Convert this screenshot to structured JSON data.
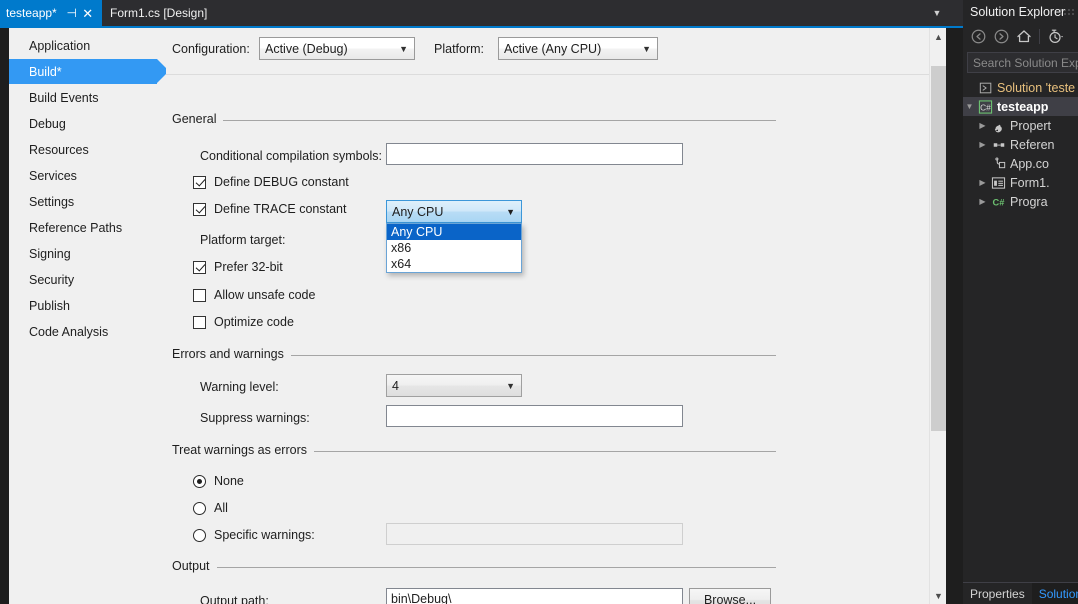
{
  "window": {
    "tabs": [
      {
        "label": "testeapp*",
        "active": true,
        "pin_icon": "pin-icon",
        "close_icon": "close-icon"
      },
      {
        "label": "Form1.cs [Design]",
        "active": false
      }
    ],
    "tabbar_overflow_icon": "chevron-down-icon"
  },
  "sidebar": {
    "items": [
      {
        "label": "Application",
        "selected": false
      },
      {
        "label": "Build*",
        "selected": true
      },
      {
        "label": "Build Events",
        "selected": false
      },
      {
        "label": "Debug",
        "selected": false
      },
      {
        "label": "Resources",
        "selected": false
      },
      {
        "label": "Services",
        "selected": false
      },
      {
        "label": "Settings",
        "selected": false
      },
      {
        "label": "Reference Paths",
        "selected": false
      },
      {
        "label": "Signing",
        "selected": false
      },
      {
        "label": "Security",
        "selected": false
      },
      {
        "label": "Publish",
        "selected": false
      },
      {
        "label": "Code Analysis",
        "selected": false
      }
    ]
  },
  "build_page": {
    "configuration_label": "Configuration:",
    "configuration_value": "Active (Debug)",
    "platform_label": "Platform:",
    "platform_value": "Active (Any CPU)",
    "general": {
      "group_title": "General",
      "conditional_symbols_label": "Conditional compilation symbols:",
      "conditional_symbols_value": "",
      "define_debug_label": "Define DEBUG constant",
      "define_debug_checked": true,
      "define_trace_label": "Define TRACE constant",
      "define_trace_checked": true,
      "platform_target_label": "Platform target:",
      "platform_target_value": "Any CPU",
      "platform_target_options": [
        "Any CPU",
        "x86",
        "x64"
      ],
      "platform_target_selected_index": 0,
      "prefer32_label": "Prefer 32-bit",
      "prefer32_checked": true,
      "unsafe_label": "Allow unsafe code",
      "unsafe_checked": false,
      "optimize_label": "Optimize code",
      "optimize_checked": false
    },
    "errors_warnings": {
      "group_title": "Errors and warnings",
      "warning_level_label": "Warning level:",
      "warning_level_value": "4",
      "suppress_warnings_label": "Suppress warnings:",
      "suppress_warnings_value": ""
    },
    "treat_warnings": {
      "group_title": "Treat warnings as errors",
      "none_label": "None",
      "none_selected": true,
      "all_label": "All",
      "all_selected": false,
      "specific_label": "Specific warnings:",
      "specific_selected": false,
      "specific_value": ""
    },
    "output": {
      "group_title": "Output",
      "output_path_label": "Output path:",
      "output_path_value": "bin\\Debug\\",
      "browse_label": "Browse..."
    },
    "scrollbar": {
      "up_icon": "chevron-up-icon",
      "down_icon": "chevron-down-icon"
    }
  },
  "solution_explorer": {
    "title": "Solution Explorer",
    "toolbar": [
      {
        "icon": "back-arrow-icon"
      },
      {
        "icon": "forward-arrow-icon"
      },
      {
        "icon": "home-icon"
      },
      {
        "icon": "pending-changes-icon"
      }
    ],
    "search_placeholder": "Search Solution Exp",
    "tree": [
      {
        "label": "Solution 'teste",
        "icon": "solution-icon",
        "indent": 0,
        "expander": "",
        "bold": false,
        "selected": false
      },
      {
        "label": "testeapp",
        "icon": "csharp-project-icon",
        "indent": 1,
        "expander": "expanded",
        "bold": true,
        "selected": true
      },
      {
        "label": "Propert",
        "icon": "wrench-icon",
        "indent": 2,
        "expander": "collapsed",
        "bold": false,
        "selected": false
      },
      {
        "label": "Referen",
        "icon": "references-icon",
        "indent": 2,
        "expander": "collapsed",
        "bold": false,
        "selected": false
      },
      {
        "label": "App.co",
        "icon": "config-file-icon",
        "indent": 2,
        "expander": "",
        "bold": false,
        "selected": false
      },
      {
        "label": "Form1.",
        "icon": "form-icon",
        "indent": 2,
        "expander": "collapsed",
        "bold": false,
        "selected": false
      },
      {
        "label": "Progra",
        "icon": "csharp-file-icon",
        "indent": 2,
        "expander": "collapsed",
        "bold": false,
        "selected": false
      }
    ],
    "bottom_tabs": [
      {
        "label": "Properties",
        "active": false
      },
      {
        "label": "Solution",
        "active": true
      }
    ]
  },
  "colors": {
    "accent_blue": "#007acc",
    "nav_selected": "#3399f3",
    "panel_bg": "#f0f0f0",
    "dark_bg": "#1e1e1e",
    "solex_bg": "#252526",
    "dropdown_selected": "#0a64c8"
  }
}
